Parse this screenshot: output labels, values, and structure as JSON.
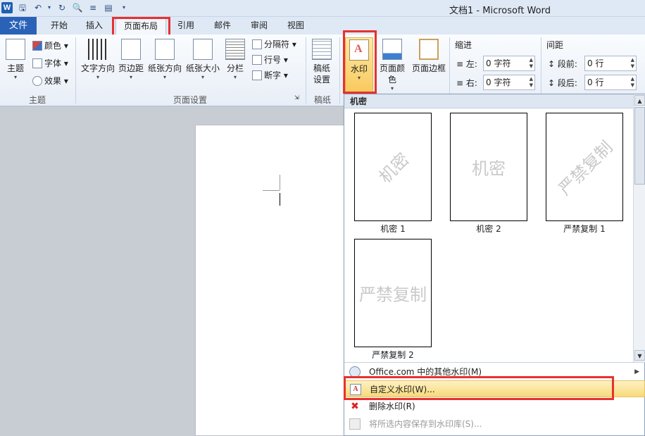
{
  "titlebar": {
    "title": "文档1 - Microsoft Word",
    "app_icon": "W"
  },
  "tabs": {
    "file": "文件",
    "home": "开始",
    "insert": "插入",
    "page_layout": "页面布局",
    "references": "引用",
    "mailings": "邮件",
    "review": "审阅",
    "view": "视图"
  },
  "ribbon": {
    "theme_group": {
      "label": "主题",
      "themes": "主题",
      "colors": "颜色",
      "fonts": "字体",
      "effects": "效果"
    },
    "page_setup_group": {
      "label": "页面设置",
      "text_direction": "文字方向",
      "margins": "页边距",
      "orientation": "纸张方向",
      "size": "纸张大小",
      "columns": "分栏",
      "breaks": "分隔符",
      "line_numbers": "行号",
      "hyphenation": "断字"
    },
    "manuscript_group": {
      "label": "稿纸",
      "manuscript_settings_line1": "稿纸",
      "manuscript_settings_line2": "设置"
    },
    "page_background_group": {
      "watermark": "水印",
      "page_color": "页面颜色",
      "page_borders": "页面边框"
    },
    "paragraph_group": {
      "indent_title": "缩进",
      "indent_left_label": "左:",
      "indent_left_value": "0 字符",
      "indent_right_label": "右:",
      "indent_right_value": "0 字符",
      "spacing_title": "间距",
      "spacing_before_label": "段前:",
      "spacing_before_value": "0 行",
      "spacing_after_label": "段后:",
      "spacing_after_value": "0 行"
    }
  },
  "watermark_gallery": {
    "header": "机密",
    "items": [
      {
        "preview": "机密",
        "caption": "机密 1"
      },
      {
        "preview": "机密",
        "caption": "机密 2"
      },
      {
        "preview": "严禁复制",
        "caption": "严禁复制 1"
      },
      {
        "preview": "严禁复制",
        "caption": "严禁复制 2"
      }
    ]
  },
  "watermark_menu": {
    "more_watermarks": "Office.com 中的其他水印(M)",
    "custom_watermark": "自定义水印(W)...",
    "remove_watermark": "删除水印(R)",
    "save_selection": "将所选内容保存到水印库(S)..."
  },
  "colors": {
    "file_tab": "#2a62b8",
    "highlight": "#e8312f",
    "hover": "#f8da7a"
  }
}
